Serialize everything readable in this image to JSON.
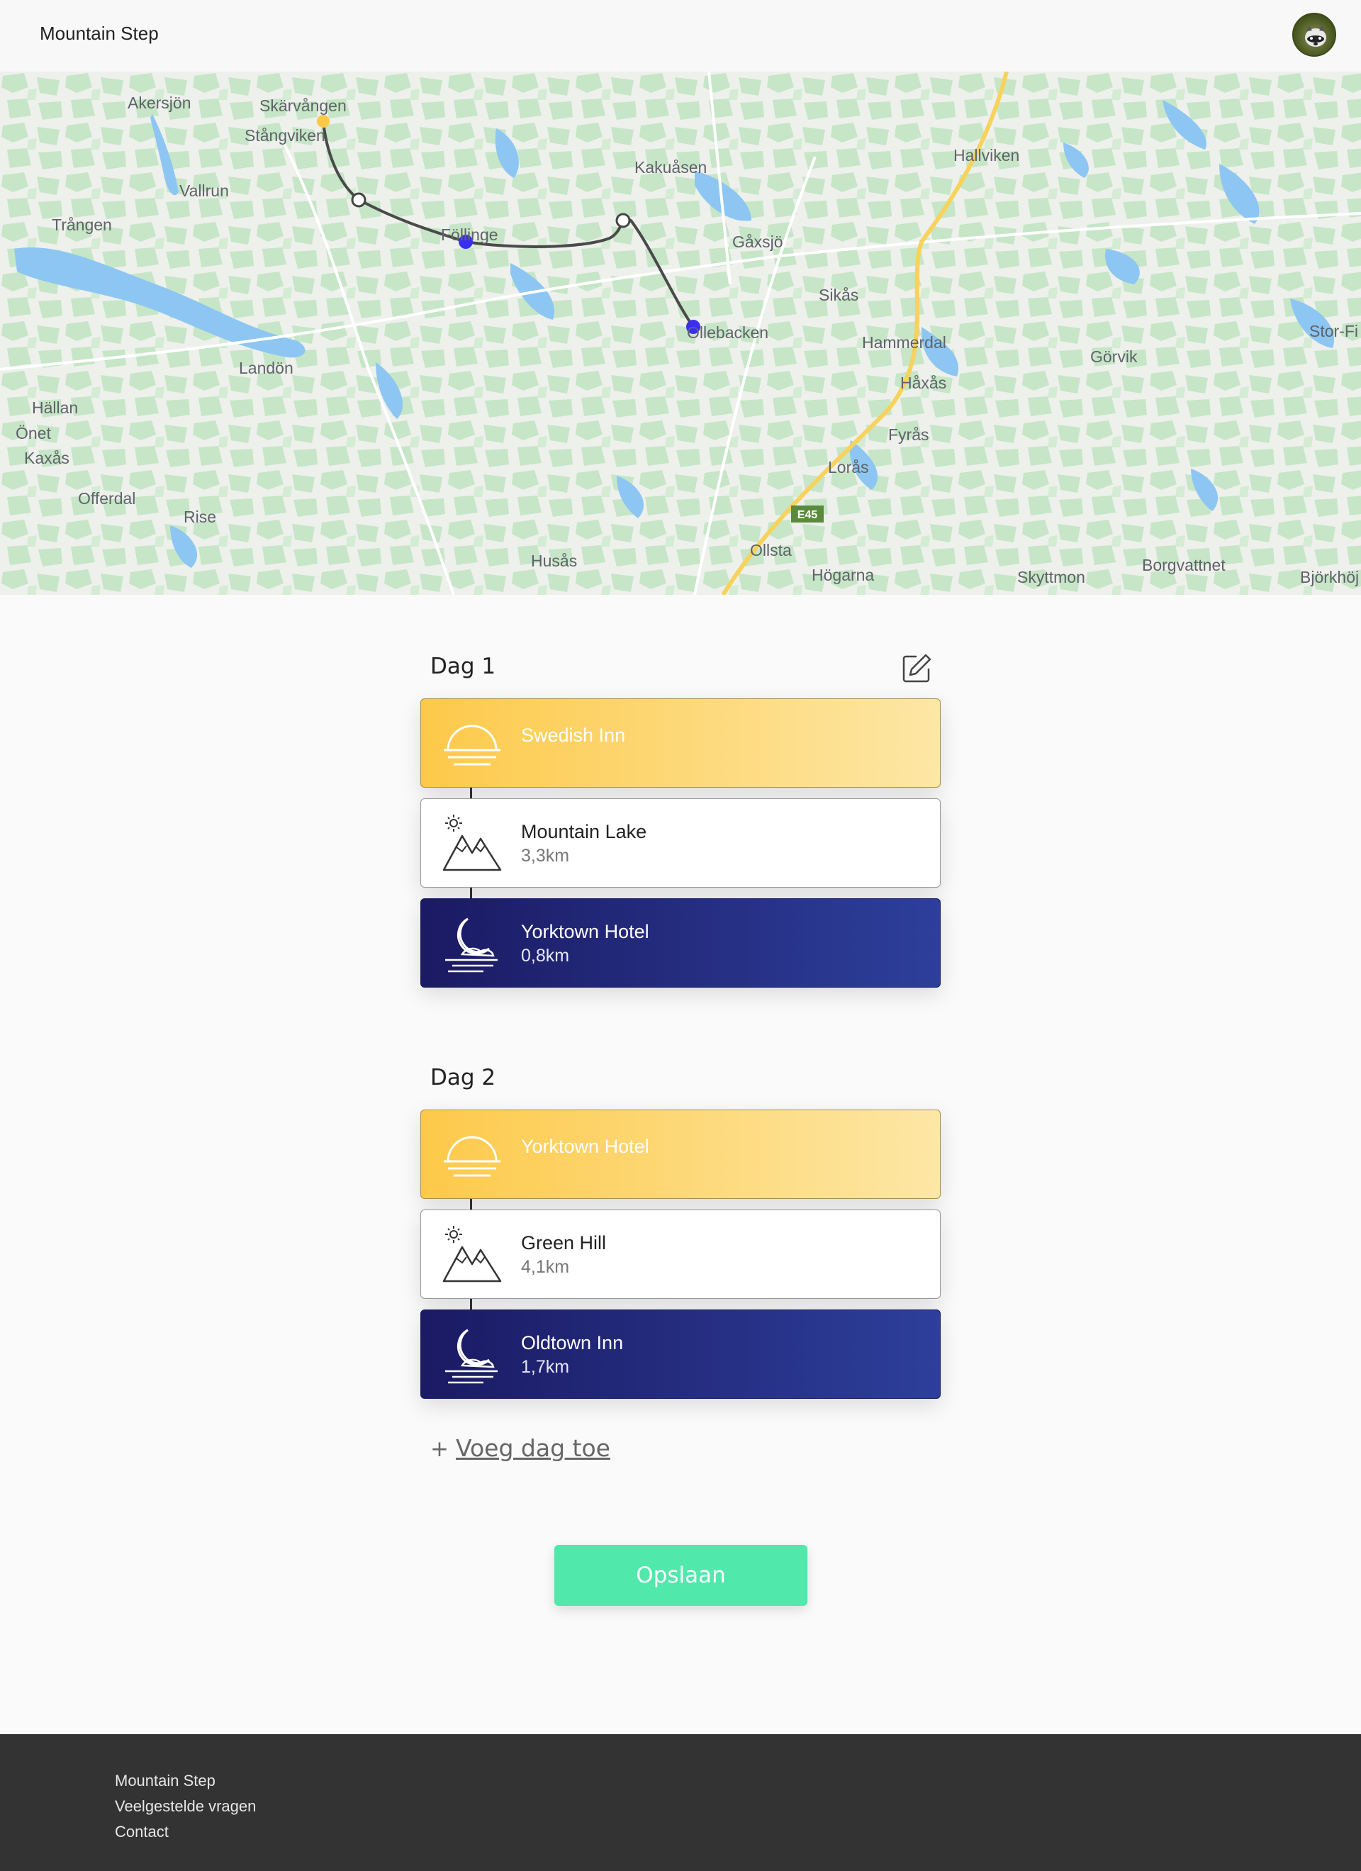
{
  "header": {
    "brand": "Mountain Step"
  },
  "map": {
    "labels": [
      {
        "text": "Akersjön"
      },
      {
        "text": "Skärvången"
      },
      {
        "text": "Stångviken"
      },
      {
        "text": "Vallrun"
      },
      {
        "text": "Trången"
      },
      {
        "text": "Föllinge"
      },
      {
        "text": "Kakuåsen"
      },
      {
        "text": "Hallviken"
      },
      {
        "text": "Gåxsjö"
      },
      {
        "text": "Sikås"
      },
      {
        "text": "Ollebacken"
      },
      {
        "text": "Hammerdal"
      },
      {
        "text": "Stor-Fi"
      },
      {
        "text": "Görvik"
      },
      {
        "text": "Håxås"
      },
      {
        "text": "Landön"
      },
      {
        "text": "Hällan"
      },
      {
        "text": "Önet"
      },
      {
        "text": "Kaxås"
      },
      {
        "text": "Offerdal"
      },
      {
        "text": "Rise"
      },
      {
        "text": "Fyrås"
      },
      {
        "text": "Lorås"
      },
      {
        "text": "Husås"
      },
      {
        "text": "Ollsta"
      },
      {
        "text": "Högarna"
      },
      {
        "text": "Skyttmon"
      },
      {
        "text": "Borgvattnet"
      },
      {
        "text": "Björkhöj"
      }
    ],
    "road_sign": "E45",
    "route_color": "#4a4a4a",
    "start_marker_color": "#fdc94a",
    "stop_marker_color": "#3a2ff0"
  },
  "days": [
    {
      "title": "Dag 1",
      "start": {
        "name": "Swedish Inn",
        "icon": "sunrise-icon"
      },
      "stop": {
        "name": "Mountain Lake",
        "distance": "3,3km",
        "icon": "mountain-icon"
      },
      "end": {
        "name": "Yorktown Hotel",
        "distance": "0,8km",
        "icon": "moon-icon"
      }
    },
    {
      "title": "Dag 2",
      "start": {
        "name": "Yorktown Hotel",
        "icon": "sunrise-icon"
      },
      "stop": {
        "name": "Green Hill",
        "distance": "4,1km",
        "icon": "mountain-icon"
      },
      "end": {
        "name": "Oldtown Inn",
        "distance": "1,7km",
        "icon": "moon-icon"
      }
    }
  ],
  "actions": {
    "add_day_plus": "+",
    "add_day": "Voeg dag toe",
    "save": "Opslaan",
    "edit_icon": "edit-icon"
  },
  "footer": {
    "links": [
      "Mountain Step",
      "Veelgestelde vragen",
      "Contact"
    ]
  },
  "colors": {
    "accent": "#50e8ab",
    "start_card": "#fdc94a",
    "end_card": "#1b1a63",
    "footer_bg": "#333333"
  }
}
